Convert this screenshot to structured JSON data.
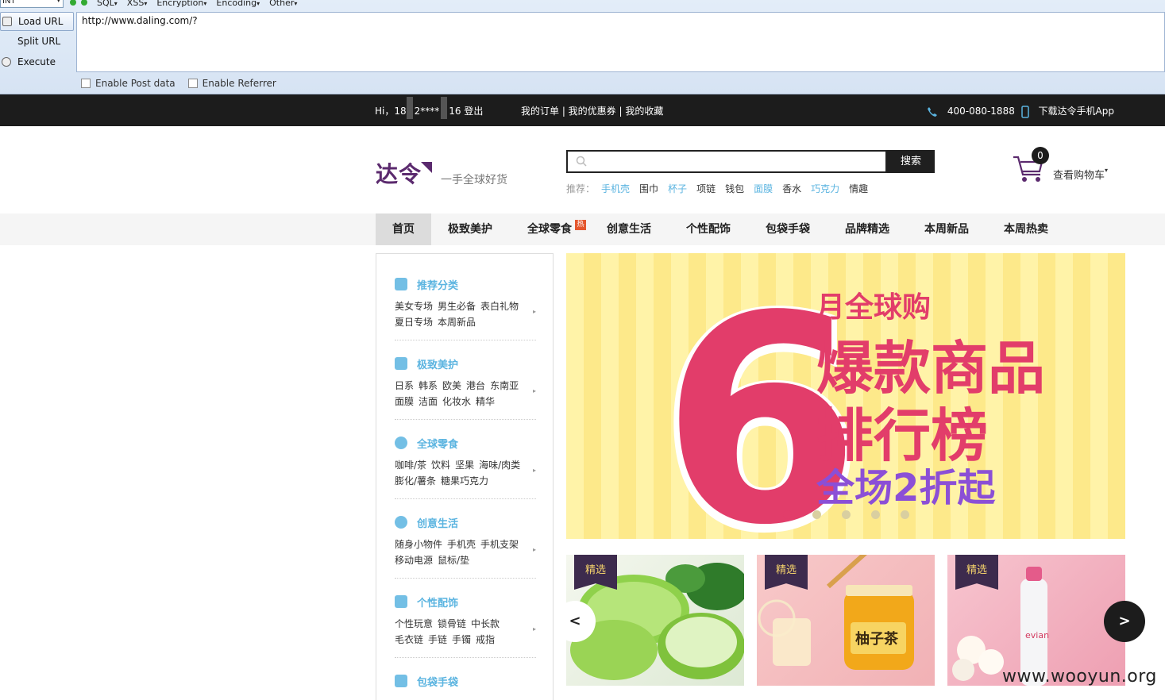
{
  "hackbar": {
    "select_value": "INT",
    "menus": [
      "SQL",
      "XSS",
      "Encryption",
      "Encoding",
      "Other"
    ],
    "buttons": [
      "Load URL",
      "Split URL",
      "Execute"
    ],
    "url_value": "http://www.daling.com/?",
    "options": [
      "Enable Post data",
      "Enable Referrer"
    ]
  },
  "topbar": {
    "greeting": "Hi，18",
    "masked": "2****",
    "user_suffix": "16 登出",
    "links": "我的订单 | 我的优惠券 | 我的收藏",
    "phone": "400-080-1888",
    "app": "下载达令手机App"
  },
  "header": {
    "logo": "达令",
    "slogan": "一手全球好货",
    "search_button": "搜索",
    "hot_label": "推荐：",
    "hot_words": [
      {
        "text": "手机壳",
        "hl": true
      },
      {
        "text": "围巾",
        "hl": false
      },
      {
        "text": "杯子",
        "hl": true
      },
      {
        "text": "项链",
        "hl": false
      },
      {
        "text": "钱包",
        "hl": false
      },
      {
        "text": "面膜",
        "hl": true
      },
      {
        "text": "香水",
        "hl": false
      },
      {
        "text": "巧克力",
        "hl": true
      },
      {
        "text": "情趣",
        "hl": false
      }
    ],
    "cart_count": "0",
    "cart_label": "查看购物车"
  },
  "nav": {
    "items": [
      "首页",
      "极致美护",
      "全球零食",
      "创意生活",
      "个性配饰",
      "包袋手袋",
      "品牌精选",
      "本周新品",
      "本周热卖"
    ],
    "hot_badge": "热"
  },
  "sidebar": {
    "categories": [
      {
        "title": "推荐分类",
        "links": [
          "美女专场",
          "男生必备",
          "表白礼物",
          "夏日专场",
          "本周新品"
        ]
      },
      {
        "title": "极致美护",
        "links": [
          "日系",
          "韩系",
          "欧美",
          "港台",
          "东南亚",
          "面膜",
          "洁面",
          "化妆水",
          "精华"
        ]
      },
      {
        "title": "全球零食",
        "links": [
          "咖啡/茶",
          "饮料",
          "坚果",
          "海味/肉类",
          "膨化/薯条",
          "糖果巧克力"
        ]
      },
      {
        "title": "创意生活",
        "links": [
          "随身小物件",
          "手机壳",
          "手机支架",
          "移动电源",
          "鼠标/垫"
        ]
      },
      {
        "title": "个性配饰",
        "links": [
          "个性玩意",
          "锁骨链",
          "中长款",
          "毛衣链",
          "手链",
          "手镯",
          "戒指"
        ]
      },
      {
        "title": "包袋手袋",
        "links": []
      }
    ]
  },
  "banner": {
    "number": "6",
    "line1": "月全球购",
    "line2": "爆款商品",
    "line3": "排行榜",
    "line4": "全场2折起",
    "colors": {
      "pink": "#e23d6a",
      "purple": "#8b4fd6",
      "yellow": "#fde98a"
    }
  },
  "cards": [
    {
      "tag": "精选",
      "product": "aloe gel"
    },
    {
      "tag": "精选",
      "product": "citron tea",
      "jar_label": "柚子茶"
    },
    {
      "tag": "精选",
      "product": "evian spray",
      "bottle_label": "evian"
    }
  ],
  "carousel": {
    "prev": "<",
    "next": ">"
  },
  "watermark": "www.wooyun.org"
}
